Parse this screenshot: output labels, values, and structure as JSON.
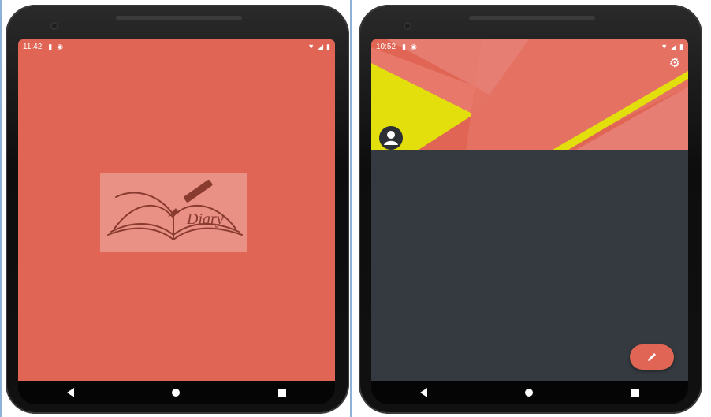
{
  "left_phone": {
    "status_time": "11:42",
    "logo_text": "Diary"
  },
  "right_phone": {
    "status_time": "10:52"
  },
  "icons": {
    "settings": "gear-icon",
    "profile": "person-icon",
    "compose": "pencil-icon",
    "nav_back": "back-triangle-icon",
    "nav_home": "home-circle-icon",
    "nav_recent": "recents-square-icon"
  },
  "colors": {
    "primary": "#e06554",
    "logo_tile": "#e99185",
    "accent_yellow": "#e2df0c",
    "body_dark": "#343a40",
    "device": "#121212"
  }
}
